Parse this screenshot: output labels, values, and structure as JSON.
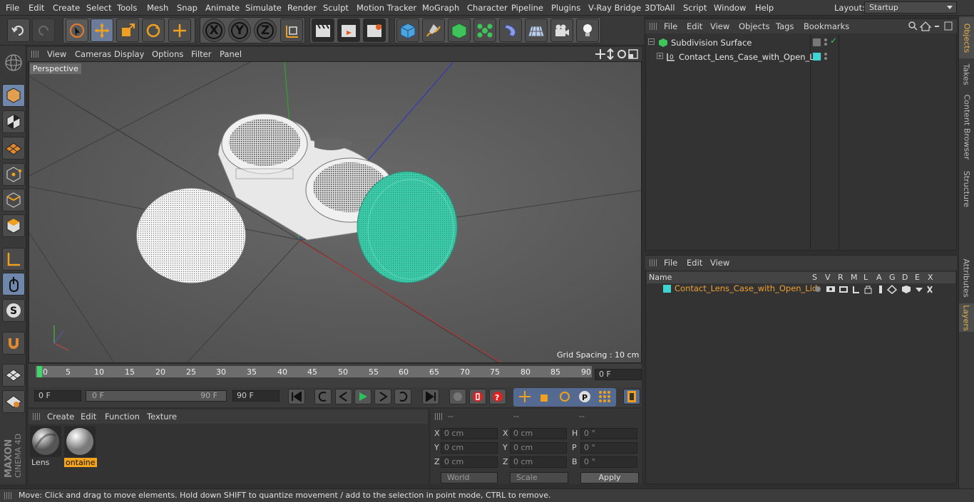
{
  "menu": [
    "File",
    "Edit",
    "Create",
    "Select",
    "Tools",
    "Mesh",
    "Snap",
    "Animate",
    "Simulate",
    "Render",
    "Sculpt",
    "Motion Tracker",
    "MoGraph",
    "Character",
    "Pipeline",
    "Plugins",
    "V-Ray Bridge",
    "3DToAll",
    "Script",
    "Window",
    "Help"
  ],
  "layout": {
    "label": "Layout:",
    "value": "Startup"
  },
  "toolbar": {
    "undo": "undo-icon",
    "redo": "redo-icon",
    "axis_x": "X",
    "axis_y": "Y",
    "axis_z": "Z"
  },
  "viewport": {
    "menu": [
      "View",
      "Cameras",
      "Display",
      "Options",
      "Filter",
      "Panel"
    ],
    "label": "Perspective",
    "grid_spacing": "Grid Spacing : 10 cm"
  },
  "timeline": {
    "ticks": [
      "0",
      "5",
      "10",
      "15",
      "20",
      "25",
      "30",
      "35",
      "40",
      "45",
      "50",
      "55",
      "60",
      "65",
      "70",
      "75",
      "80",
      "85",
      "90"
    ],
    "current_frame": "0 F"
  },
  "transport": {
    "start": "0 F",
    "range_start": "0 F",
    "range_end": "90 F",
    "end": "90 F"
  },
  "material_manager": {
    "menu": [
      "Create",
      "Edit",
      "Function",
      "Texture"
    ],
    "materials": [
      {
        "label": "Lens",
        "selected": false
      },
      {
        "label": "ontaine",
        "selected": true
      }
    ]
  },
  "coordinates": {
    "headers": [
      "--",
      "--",
      "--"
    ],
    "rows": [
      {
        "a": "X",
        "av": "0 cm",
        "b": "X",
        "bv": "0 cm",
        "c": "H",
        "cv": "0 °"
      },
      {
        "a": "Y",
        "av": "0 cm",
        "b": "Y",
        "bv": "0 cm",
        "c": "P",
        "cv": "0 °"
      },
      {
        "a": "Z",
        "av": "0 cm",
        "b": "Z",
        "bv": "0 cm",
        "c": "B",
        "cv": "0 °"
      }
    ],
    "mode1": "World",
    "mode2": "Scale",
    "apply": "Apply"
  },
  "object_manager": {
    "menu": [
      "File",
      "Edit",
      "View",
      "Objects",
      "Tags",
      "Bookmarks"
    ],
    "objects": [
      {
        "name": "Subdivision Surface"
      },
      {
        "name": "Contact_Lens_Case_with_Open_Lid"
      }
    ]
  },
  "layer_manager": {
    "menu": [
      "File",
      "Edit",
      "View"
    ],
    "columns": [
      "Name",
      "S",
      "V",
      "R",
      "M",
      "L",
      "A",
      "G",
      "D",
      "E",
      "X"
    ],
    "layers": [
      {
        "name": "Contact_Lens_Case_with_Open_Lid",
        "color": "#3fd3d3"
      }
    ]
  },
  "side_tabs": [
    "Objects",
    "Takes",
    "Content Browser",
    "Structure",
    "Attributes",
    "Layers"
  ],
  "status": "Move: Click and drag to move elements. Hold down SHIFT to quantize movement / add to the selection in point mode, CTRL to remove.",
  "branding": {
    "maxon": "MAXON",
    "cinema": "CINEMA 4D"
  },
  "colors": {
    "accent": "#f4a31f",
    "layer": "#3fd3d3",
    "selected_tool": "#6f87aa"
  }
}
